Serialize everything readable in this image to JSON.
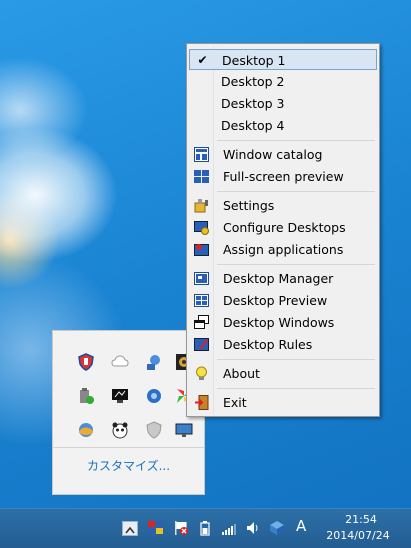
{
  "context_menu": {
    "items": [
      {
        "label": "Desktop 1",
        "checked": true,
        "highlighted": true
      },
      {
        "label": "Desktop 2"
      },
      {
        "label": "Desktop 3"
      },
      {
        "label": "Desktop 4"
      },
      {
        "label": "Window catalog",
        "icon": "window-catalog-icon"
      },
      {
        "label": "Full-screen preview",
        "icon": "fullscreen-preview-icon"
      },
      {
        "label": "Settings",
        "icon": "settings-icon"
      },
      {
        "label": "Configure Desktops",
        "icon": "configure-desktops-icon"
      },
      {
        "label": "Assign applications",
        "icon": "assign-applications-icon"
      },
      {
        "label": "Desktop Manager",
        "icon": "desktop-manager-icon"
      },
      {
        "label": "Desktop Preview",
        "icon": "desktop-preview-icon"
      },
      {
        "label": "Desktop Windows",
        "icon": "desktop-windows-icon"
      },
      {
        "label": "Desktop Rules",
        "icon": "desktop-rules-icon"
      },
      {
        "label": "About",
        "icon": "lightbulb-icon"
      },
      {
        "label": "Exit",
        "icon": "exit-icon"
      }
    ],
    "checkmark": "✔"
  },
  "tray_popup": {
    "customize_label": "カスタマイズ...",
    "icons": [
      "shield-icon",
      "cloud-icon",
      "messenger-icon",
      "camera-icon",
      "battery-icon",
      "monitor-app-icon",
      "globe-icon",
      "pinwheel-icon",
      "sunset-icon",
      "panda-icon",
      "security-shield-icon",
      "display-icon"
    ]
  },
  "taskbar": {
    "time": "21:54",
    "date": "2014/07/24",
    "ime_label": "A"
  },
  "colors": {
    "menu_bg": "#f0f0f0",
    "highlight_bg": "#d8e6f3",
    "taskbar_bg": "#245e92",
    "link_blue": "#1c6fbe"
  }
}
